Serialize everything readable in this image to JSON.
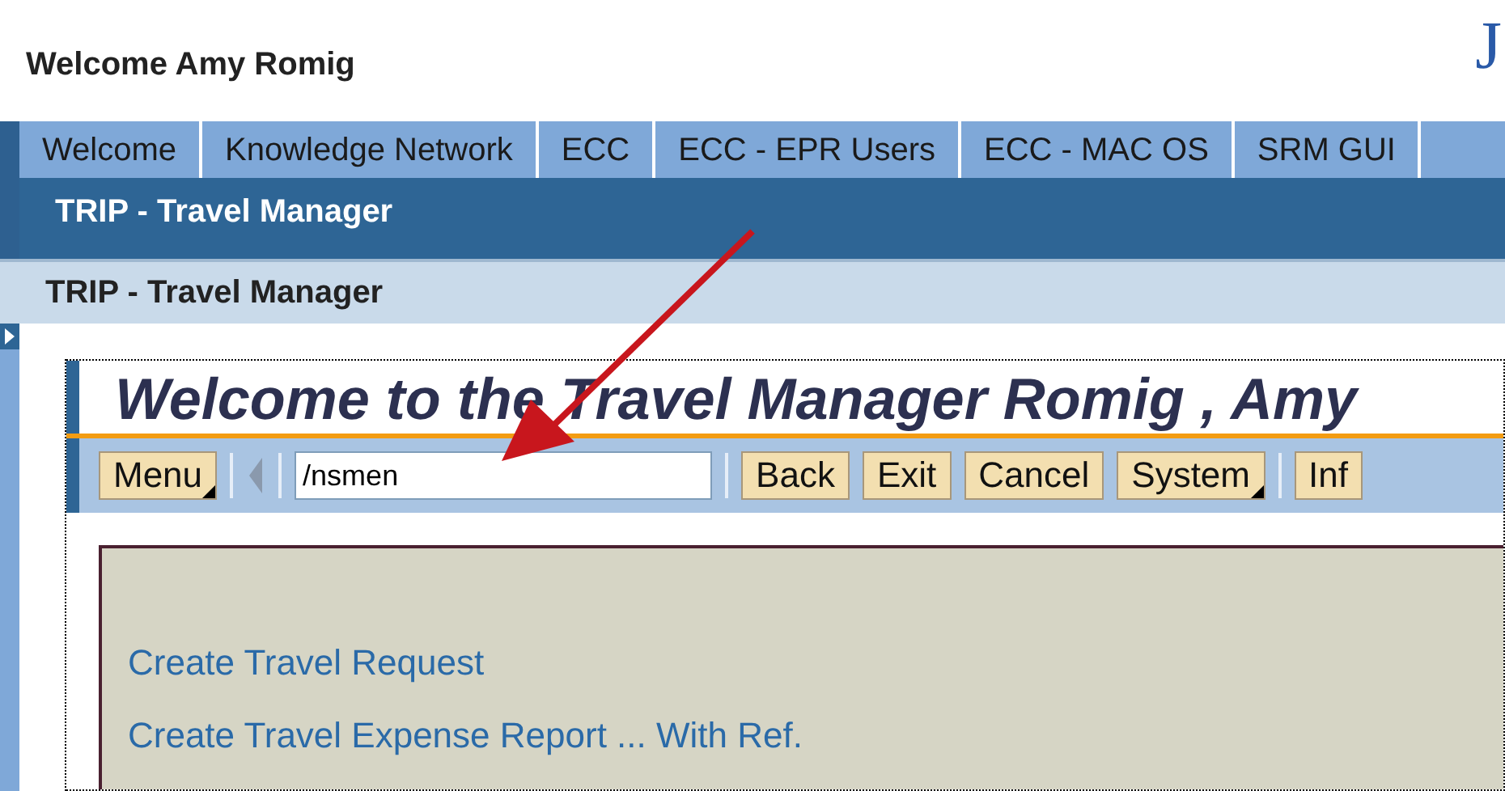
{
  "header": {
    "welcome": "Welcome Amy Romig",
    "logo": "J"
  },
  "tabs": [
    {
      "label": "Welcome"
    },
    {
      "label": "Knowledge Network"
    },
    {
      "label": "ECC"
    },
    {
      "label": "ECC - EPR Users"
    },
    {
      "label": "ECC - MAC OS"
    },
    {
      "label": "SRM GUI"
    }
  ],
  "subnav": {
    "label": "TRIP - Travel Manager"
  },
  "page_title": "TRIP - Travel Manager",
  "app": {
    "title": "Welcome to the Travel Manager Romig , Amy",
    "toolbar": [
      {
        "kind": "menu",
        "label": "Menu"
      },
      {
        "kind": "back-arrow"
      },
      {
        "kind": "field",
        "value": "/nsmen"
      },
      {
        "kind": "button",
        "label": "Back"
      },
      {
        "kind": "button",
        "label": "Exit"
      },
      {
        "kind": "button",
        "label": "Cancel"
      },
      {
        "kind": "menu",
        "label": "System"
      },
      {
        "kind": "button",
        "label": "Inf"
      }
    ],
    "links": [
      "Create Travel Request",
      "Create Travel Expense Report ... With Ref."
    ]
  }
}
